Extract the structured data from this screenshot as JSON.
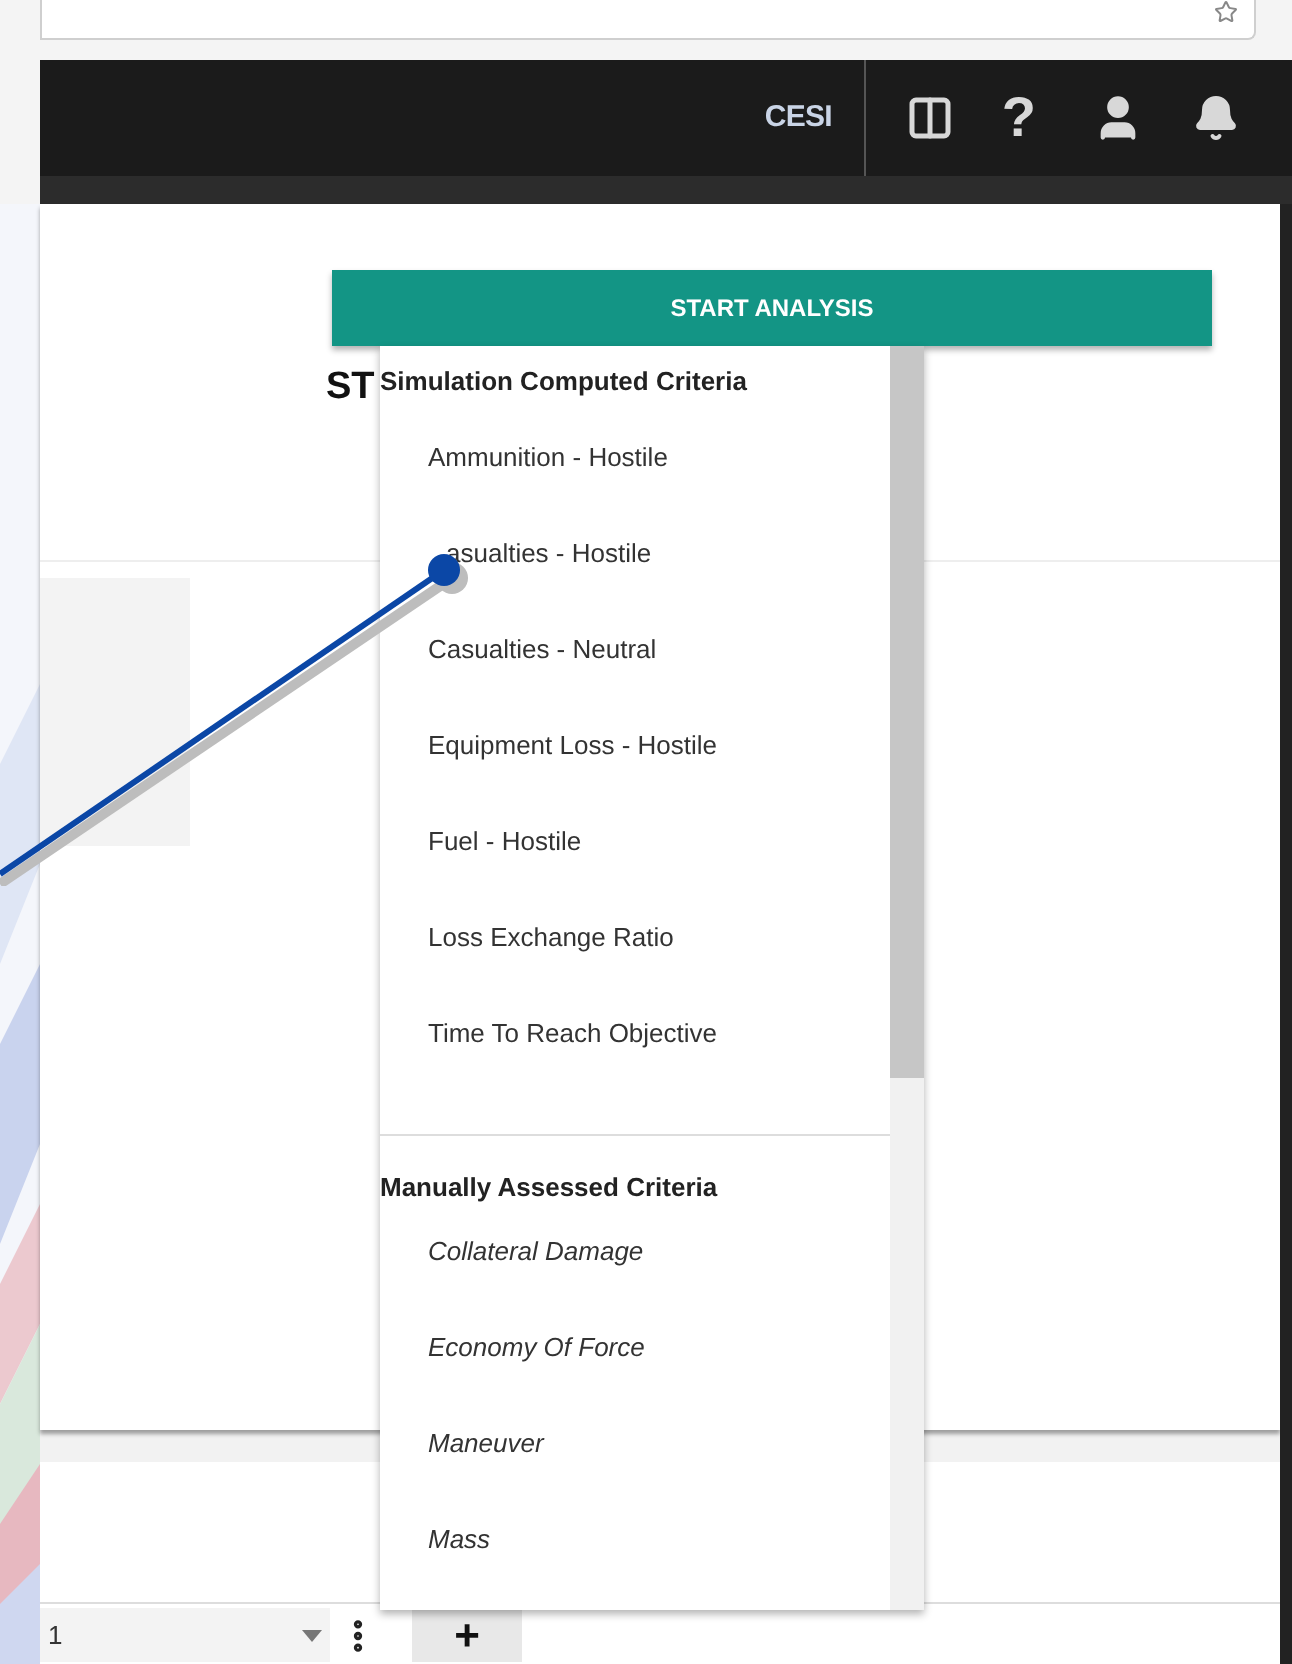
{
  "header": {
    "org": "CESI",
    "help": "?"
  },
  "start_button": {
    "label": "START ANALYSIS"
  },
  "heading": "ST",
  "menu": {
    "sections": [
      {
        "title": "Simulation Computed Criteria",
        "kind": "computed",
        "items": [
          "Ammunition - Hostile",
          "asualties - Hostile",
          "Casualties - Neutral",
          "Equipment Loss - Hostile",
          "Fuel - Hostile",
          "Loss Exchange Ratio",
          "Time To Reach Objective"
        ]
      },
      {
        "title": "Manually Assessed Criteria",
        "kind": "manual",
        "items": [
          "Collateral Damage",
          "Economy Of Force",
          "Maneuver",
          "Mass"
        ]
      }
    ]
  },
  "bottom_row": {
    "select_value": "1",
    "add": "+"
  }
}
